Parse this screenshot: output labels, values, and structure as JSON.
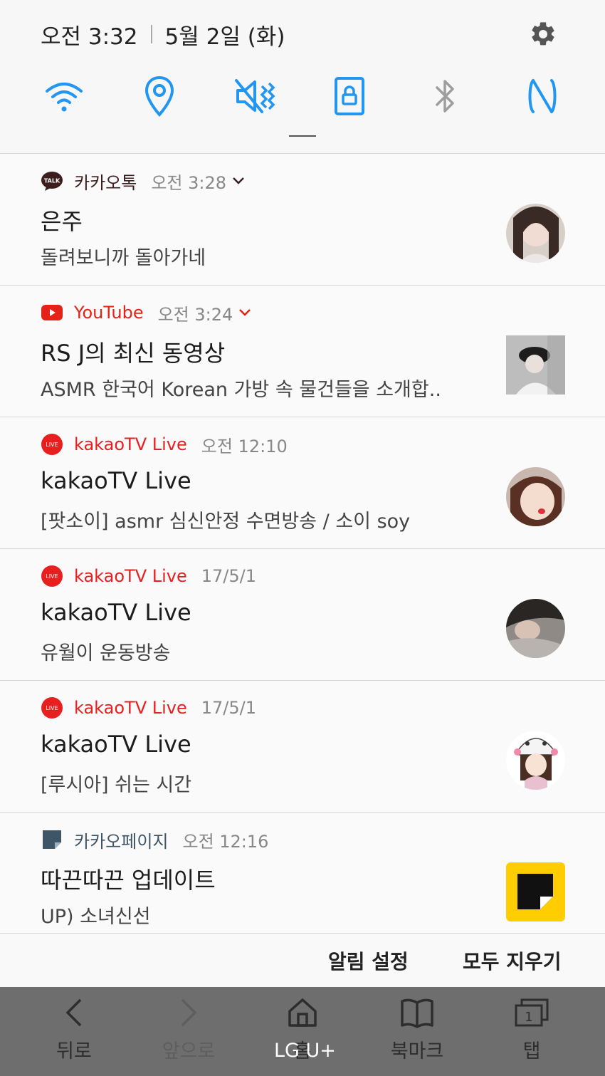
{
  "status": {
    "time": "오전 3:32",
    "date": "5월 2일 (화)"
  },
  "quick_settings": [
    {
      "name": "wifi-icon",
      "active": true
    },
    {
      "name": "location-icon",
      "active": true
    },
    {
      "name": "mute-vibrate-icon",
      "active": true
    },
    {
      "name": "screen-lock-icon",
      "active": true
    },
    {
      "name": "bluetooth-icon",
      "active": false
    },
    {
      "name": "nfc-icon",
      "active": true
    }
  ],
  "colors": {
    "accent": "#2196f3",
    "kakaotalk": "#3c1e1e",
    "youtube": "#e62117",
    "kakaotv": "#e81f1f",
    "kakaopage": "#3e5467"
  },
  "notifications": [
    {
      "app": "카카오톡",
      "time": "오전 3:28",
      "expandable": true,
      "title": "은주",
      "body": "돌려보니까 돌아가네",
      "icon": "kakaotalk-icon"
    },
    {
      "app": "YouTube",
      "time": "오전 3:24",
      "expandable": true,
      "title": "RS J의 최신 동영상",
      "body": "ASMR 한국어 Korean 가방 속 물건들을 소개합..",
      "icon": "youtube-icon"
    },
    {
      "app": "kakaoTV Live",
      "time": "오전 12:10",
      "expandable": false,
      "title": "kakaoTV Live",
      "body": "[팟소이] asmr 심신안정 수면방송 / 소이 soy",
      "icon": "kakaotv-live-icon"
    },
    {
      "app": "kakaoTV Live",
      "time": "17/5/1",
      "expandable": false,
      "title": "kakaoTV Live",
      "body": "유월이 운동방송",
      "icon": "kakaotv-live-icon"
    },
    {
      "app": "kakaoTV Live",
      "time": "17/5/1",
      "expandable": false,
      "title": "kakaoTV Live",
      "body": "[루시아] 쉬는 시간",
      "icon": "kakaotv-live-icon"
    },
    {
      "app": "카카오페이지",
      "time": "오전 12:16",
      "expandable": false,
      "title": "따끈따끈 업데이트",
      "body": "UP) 소녀신선",
      "icon": "kakaopage-icon"
    }
  ],
  "live_badge": "LIVE",
  "talk_badge": "TALK",
  "actions": {
    "settings_label": "알림 설정",
    "clear_label": "모두 지우기"
  },
  "browser_bar": {
    "back": "뒤로",
    "forward": "앞으로",
    "home": "홈",
    "bookmarks": "북마크",
    "tabs": "탭",
    "tab_count": "1",
    "carrier": "LG U+"
  }
}
